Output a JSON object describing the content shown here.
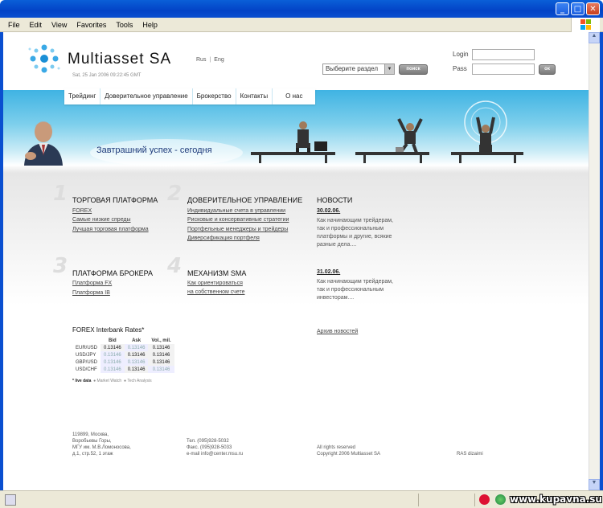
{
  "browser": {
    "menu": [
      "File",
      "Edit",
      "View",
      "Favorites",
      "Tools",
      "Help"
    ],
    "watermark": "www.kupavna.su"
  },
  "header": {
    "brand": "Multiasset SA",
    "datetime": "Sat, 25 Jan 2006 09:22:45 GMT",
    "lang_ru": "Rus",
    "lang_en": "Eng",
    "section_select": "Выберите раздел",
    "search_button": "поиск",
    "login_label": "Login",
    "pass_label": "Pass",
    "ok_button": "ок"
  },
  "nav": [
    "Трейдинг",
    "Доверительное управление",
    "Брокерство",
    "Контакты",
    "О нас"
  ],
  "banner": {
    "slogan": "Завтрашний успех - сегодня"
  },
  "sections": {
    "s1": {
      "num": "1",
      "title": "ТОРГОВАЯ ПЛАТФОРМА",
      "links": [
        "FOREX",
        "Самые низкие спреды",
        "Лучшая торговая платформа"
      ]
    },
    "s2": {
      "num": "2",
      "title": "ДОВЕРИТЕЛЬНОЕ УПРАВЛЕНИЕ",
      "links": [
        "Индивидуальные счета в управлении",
        "Рисковые и консервативные стратегии",
        "Портфельные менеджеры и трейдеры",
        "Диверсификация портфеля"
      ]
    },
    "s3": {
      "num": "3",
      "title": "ПЛАТФОРМА БРОКЕРА",
      "links": [
        "Платформа FX",
        "Платформа IB"
      ]
    },
    "s4": {
      "num": "4",
      "title": "МЕХАНИЗМ SMA",
      "links": [
        "Как ориентироваться",
        "на собственном счете"
      ]
    }
  },
  "news": {
    "title": "НОВОСТИ",
    "items": [
      {
        "date": "30.02.06.",
        "text": "Как начинающим трейдерам, так и профессиональным платформы и другие, всякие разные дела...."
      },
      {
        "date": "31.02.06.",
        "text": "Как начинающим трейдерам, так и профессиональным инвесторам...."
      }
    ],
    "archive": "Архив новостей"
  },
  "rates": {
    "title": "FOREX Interbank Rates*",
    "headers": [
      "",
      "Bid",
      "Ask",
      "Vol., mil."
    ],
    "rows": [
      {
        "pair": "EUR/USD",
        "bid": "0.13146",
        "ask": "0.13146",
        "vol": "0.13146"
      },
      {
        "pair": "USD/JPY",
        "bid": "0.13146",
        "ask": "0.13146",
        "vol": "0.13146"
      },
      {
        "pair": "GBP/USD",
        "bid": "0.13146",
        "ask": "0.13146",
        "vol": "0.13146"
      },
      {
        "pair": "USD/CHF",
        "bid": "0.13146",
        "ask": "0.13146",
        "vol": "0.13146"
      }
    ],
    "legend_live": "* live data",
    "legend_watch": "Market Watch",
    "legend_tech": "Tech Analysis"
  },
  "footer": {
    "address": [
      "119899, Москва,",
      "Воробьевы Горы,",
      "МГУ им. М.В.Ломоносова,",
      "д.1, стр.52, 1 этаж"
    ],
    "contacts": [
      "Тел. (095)928-5032",
      "Факс. (095)928-5033",
      "e-mail info@center.msu.ru"
    ],
    "rights": [
      "All rights reserved",
      "Copyright 2006 Multiasset SA"
    ],
    "design": "RAS dizaimi"
  },
  "colors": {
    "banner_blue": "#3fb3e3",
    "titlebar_blue": "#0343c6"
  }
}
